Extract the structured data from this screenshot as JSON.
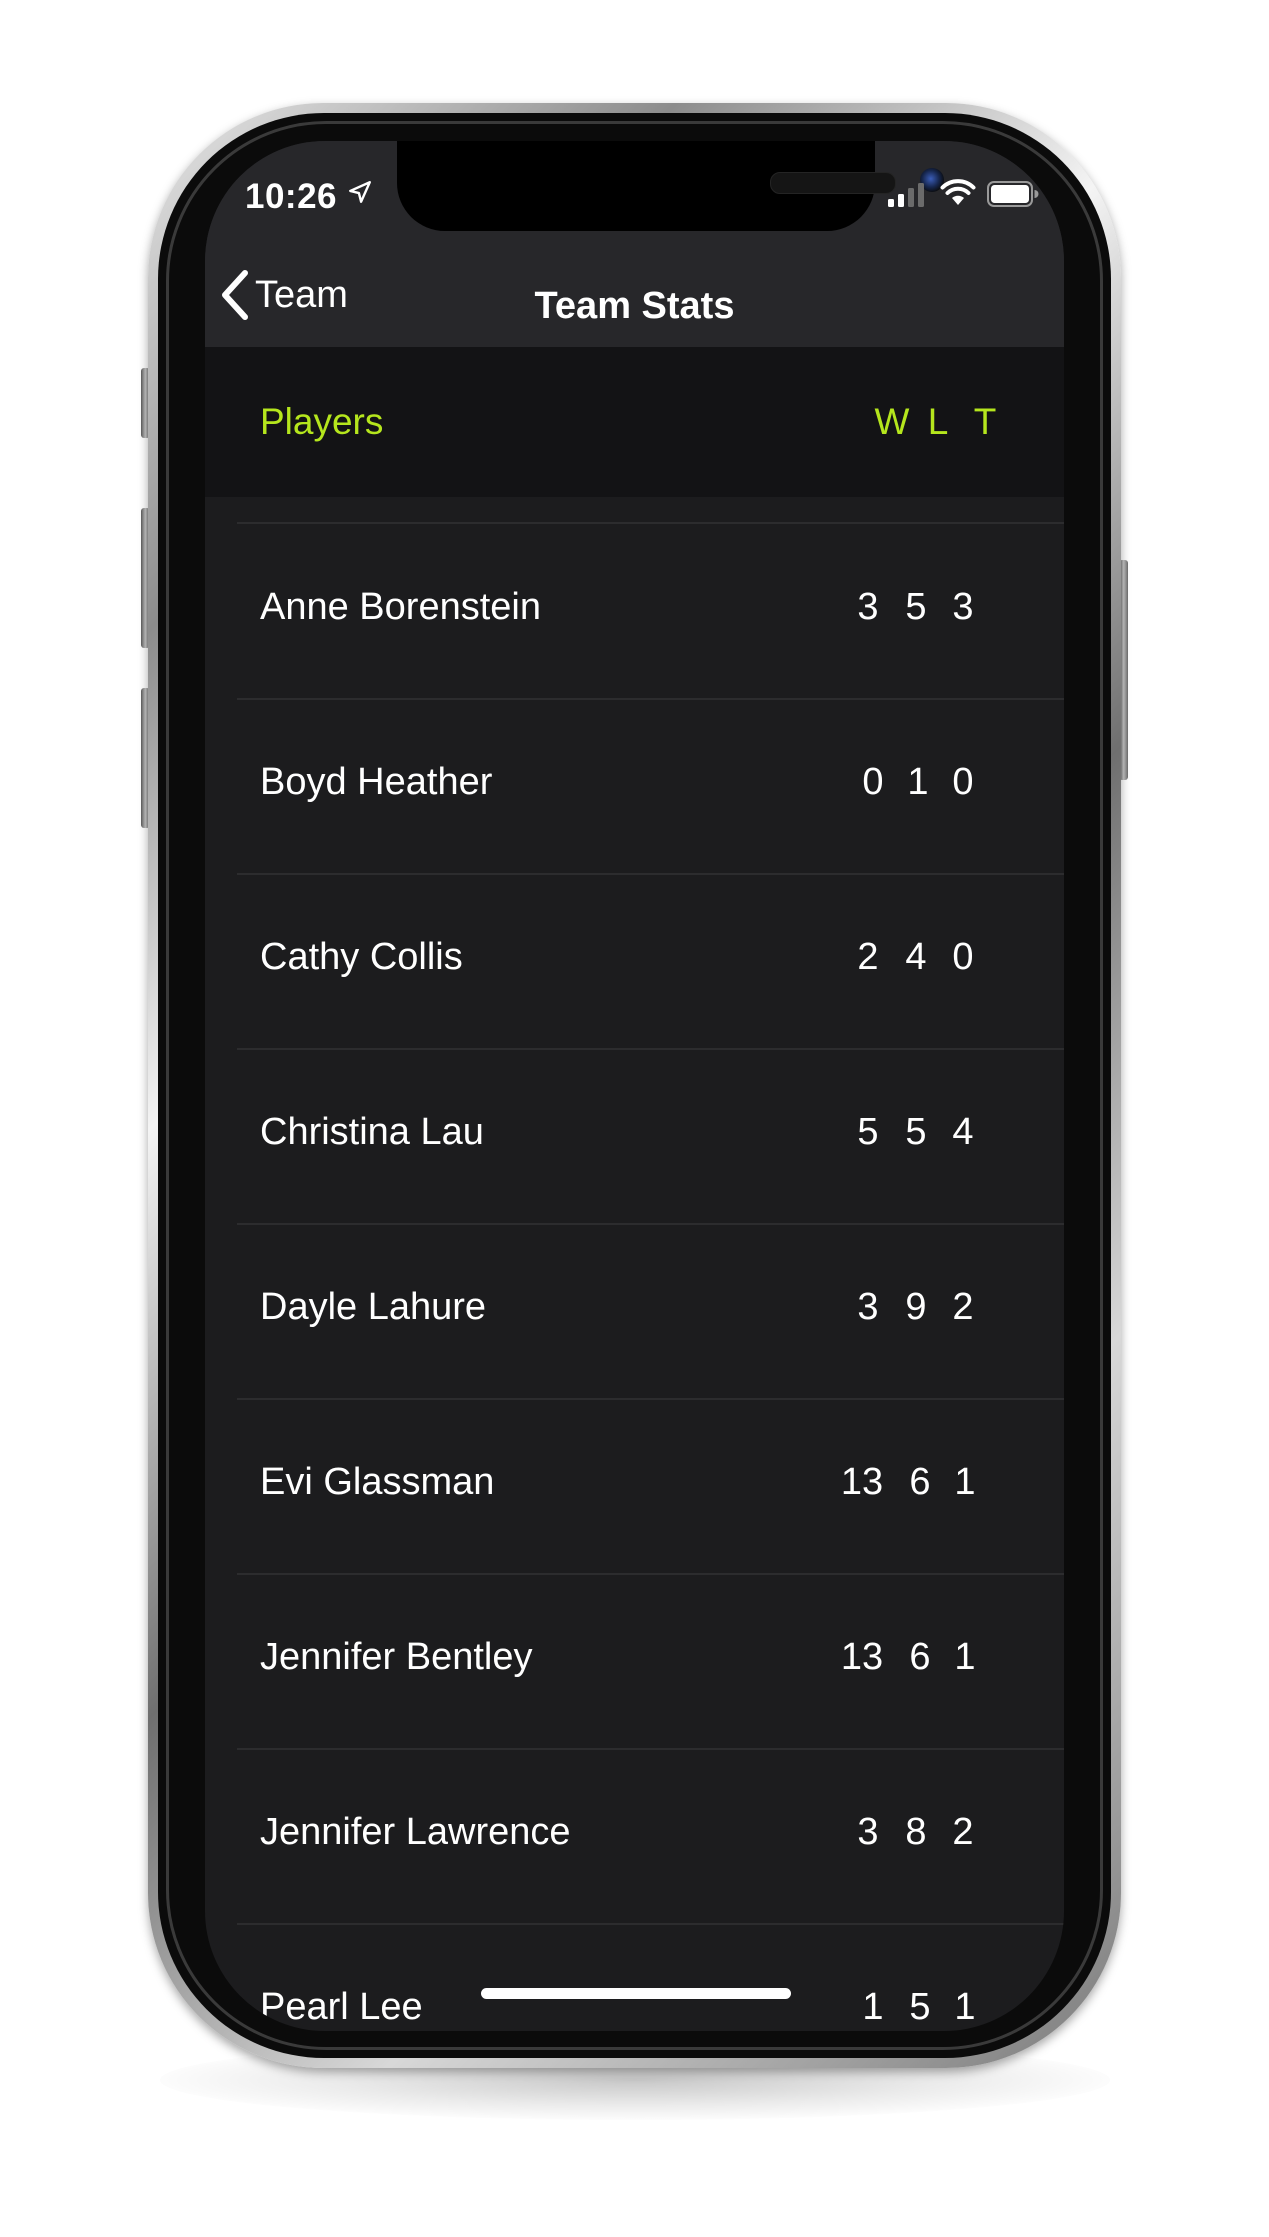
{
  "status_bar": {
    "time": "10:26",
    "location_icon": "location-arrow-icon",
    "signal_icon": "cellular-signal-icon",
    "wifi_icon": "wifi-icon",
    "battery_icon": "battery-icon"
  },
  "nav": {
    "back_label": "Team",
    "back_icon": "chevron-left-icon",
    "title": "Team Stats"
  },
  "table": {
    "header": {
      "players": "Players",
      "w": "W",
      "l": "L",
      "t": "T"
    },
    "rows": [
      {
        "name": "Anne Borenstein",
        "w": "3",
        "l": "5",
        "t": "3"
      },
      {
        "name": "Boyd Heather",
        "w": "0",
        "l": "1",
        "t": "0"
      },
      {
        "name": "Cathy Collis",
        "w": "2",
        "l": "4",
        "t": "0"
      },
      {
        "name": "Christina Lau",
        "w": "5",
        "l": "5",
        "t": "4"
      },
      {
        "name": "Dayle Lahure",
        "w": "3",
        "l": "9",
        "t": "2"
      },
      {
        "name": "Evi Glassman",
        "w": "13",
        "l": "6",
        "t": "1"
      },
      {
        "name": "Jennifer Bentley",
        "w": "13",
        "l": "6",
        "t": "1"
      },
      {
        "name": "Jennifer Lawrence",
        "w": "3",
        "l": "8",
        "t": "2"
      },
      {
        "name": "Pearl Lee",
        "w": "1",
        "l": "5",
        "t": "1"
      }
    ]
  },
  "colors": {
    "accent": "#b5e61d",
    "background": "#1c1c1e",
    "header_background": "#131315",
    "nav_background": "#27272a",
    "text": "#ffffff"
  }
}
